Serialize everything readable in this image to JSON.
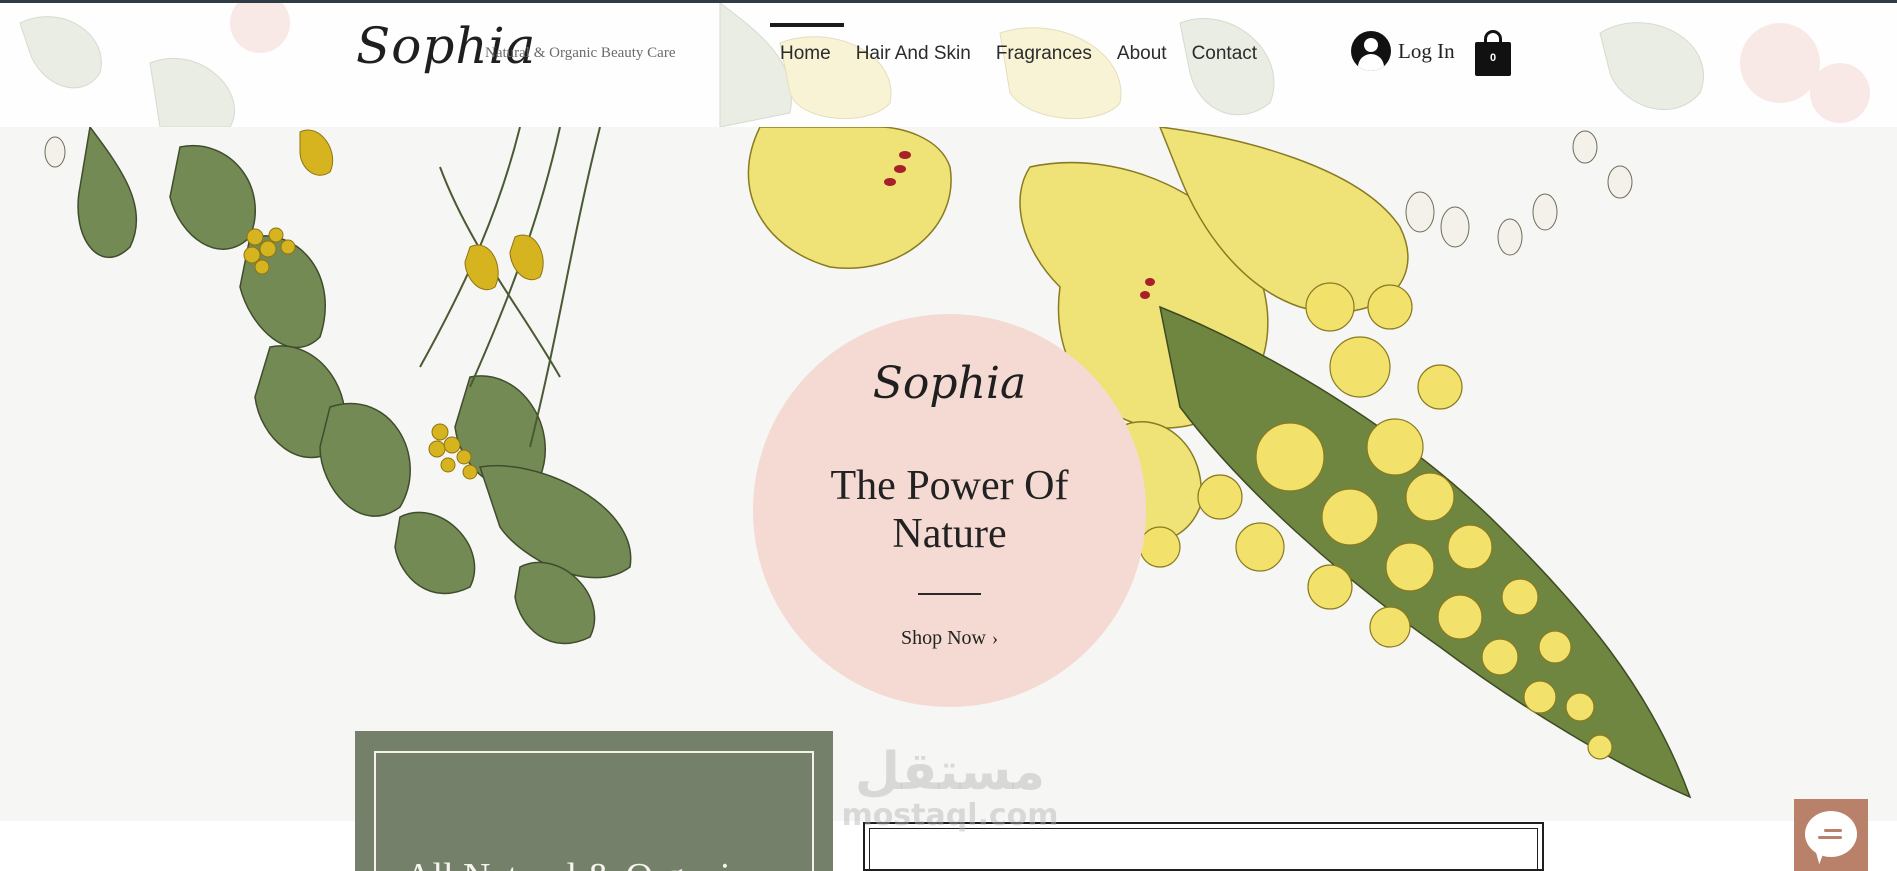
{
  "header": {
    "logo": "Sophia",
    "tagline": "Natural & Organic Beauty Care",
    "nav": [
      {
        "label": "Home",
        "active": true
      },
      {
        "label": "Hair And Skin",
        "active": false
      },
      {
        "label": "Fragrances",
        "active": false
      },
      {
        "label": "About",
        "active": false
      },
      {
        "label": "Contact",
        "active": false
      }
    ],
    "login_label": "Log In",
    "cart_count": "0"
  },
  "hero": {
    "brand": "Sophia",
    "title": "The Power Of Nature",
    "cta_label": "Shop Now",
    "cta_icon": "chevron-right-icon",
    "circle_color": "#f4dad2"
  },
  "section": {
    "card_title": "All Natural & Organic",
    "card_color": "#75806a"
  },
  "watermark": {
    "arabic": "مستقل",
    "latin": "mostaql.com"
  },
  "chat": {
    "icon": "chat-icon",
    "color": "#b9806a"
  }
}
